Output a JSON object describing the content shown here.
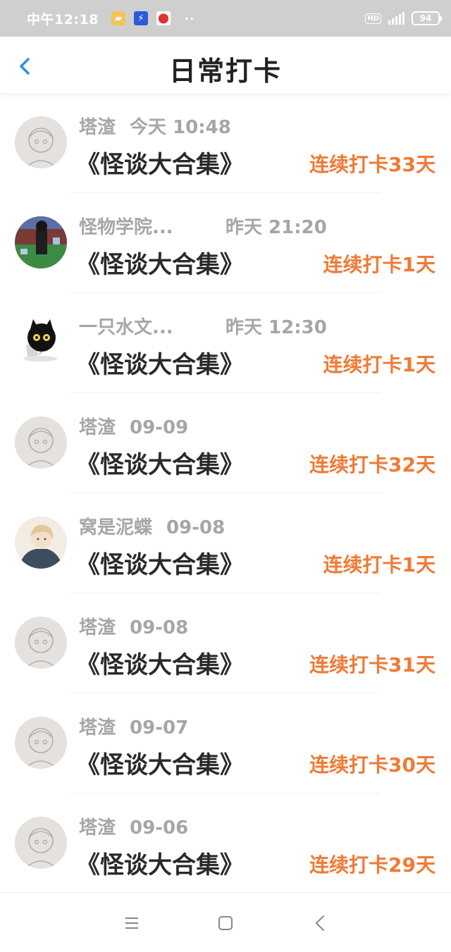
{
  "status_bar": {
    "time": "中午12:18",
    "battery": "94",
    "icons": [
      "folder-icon",
      "bolt-icon",
      "map-pin-icon",
      "hd-icon",
      "signal-icon"
    ]
  },
  "header": {
    "title": "日常打卡",
    "back_icon": "chevron-left-icon"
  },
  "colors": {
    "accent": "#f07a36",
    "back": "#2f8de4",
    "status_bar_bg": "#cfcfcf"
  },
  "items": [
    {
      "user": "塔渣",
      "time": "今天 10:48",
      "title": "《怪谈大合集》",
      "streak": "连续打卡33天"
    },
    {
      "user": "怪物学院...",
      "time": "昨天 21:20",
      "title": "《怪谈大合集》",
      "streak": "连续打卡1天"
    },
    {
      "user": "一只水文...",
      "time": "昨天 12:30",
      "title": "《怪谈大合集》",
      "streak": "连续打卡1天"
    },
    {
      "user": "塔渣",
      "time": "09-09",
      "title": "《怪谈大合集》",
      "streak": "连续打卡32天"
    },
    {
      "user": "窝是泥蝶",
      "time": "09-08",
      "title": "《怪谈大合集》",
      "streak": "连续打卡1天"
    },
    {
      "user": "塔渣",
      "time": "09-08",
      "title": "《怪谈大合集》",
      "streak": "连续打卡31天"
    },
    {
      "user": "塔渣",
      "time": "09-07",
      "title": "《怪谈大合集》",
      "streak": "连续打卡30天"
    },
    {
      "user": "塔渣",
      "time": "09-06",
      "title": "《怪谈大合集》",
      "streak": "连续打卡29天"
    }
  ],
  "navbar": {
    "icons": [
      "menu-icon",
      "home-square-icon",
      "back-triangle-icon"
    ]
  }
}
